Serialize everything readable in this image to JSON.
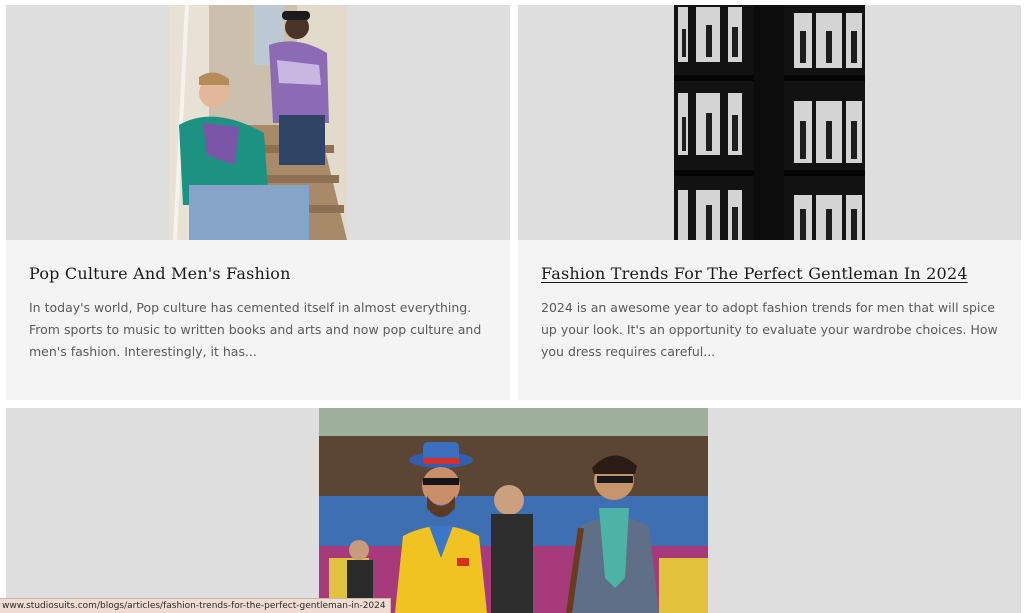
{
  "articles": [
    {
      "title": "Pop Culture And Men's Fashion",
      "excerpt": "In today's world, Pop culture has cemented itself in almost everything. From sports to music to written books and arts and now pop culture and men's fashion. Interestingly, it has..."
    },
    {
      "title": "Fashion Trends For The Perfect Gentleman In 2024",
      "excerpt": "2024 is an awesome year to adopt fashion trends for men that will spice up your look. It's an opportunity to evaluate your wardrobe choices. How you dress requires careful..."
    }
  ],
  "status_url": "www.studiosuits.com/blogs/articles/fashion-trends-for-the-perfect-gentleman-in-2024"
}
